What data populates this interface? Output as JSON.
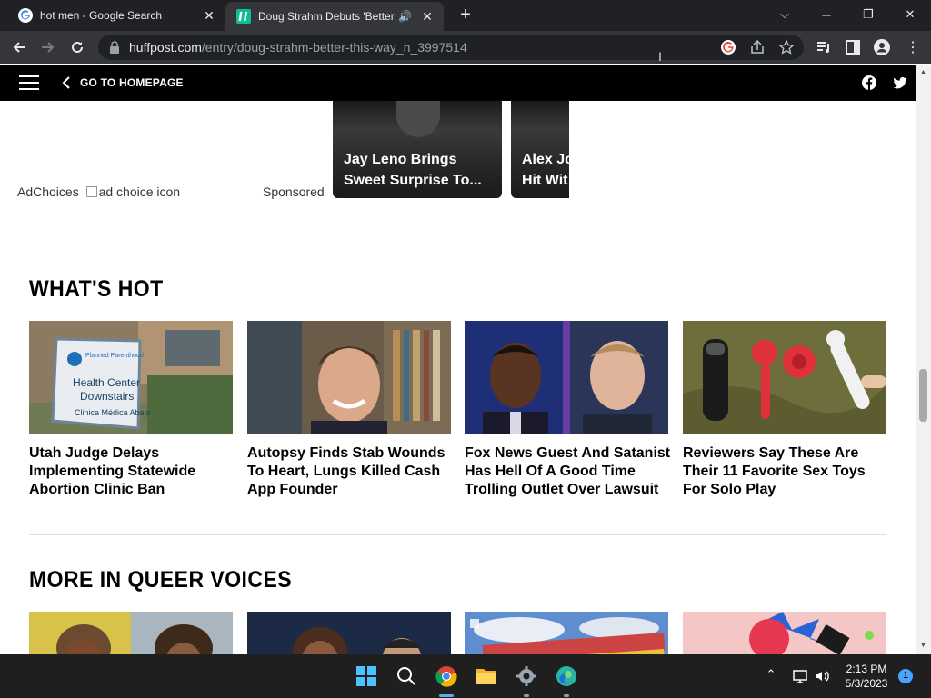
{
  "browser": {
    "tabs": [
      {
        "title": "hot men - Google Search",
        "active": false
      },
      {
        "title": "Doug Strahm Debuts 'Better",
        "active": true,
        "audio": true
      }
    ],
    "url_host": "huffpost.com",
    "url_path": "/entry/doug-strahm-better-this-way_n_3997514"
  },
  "site_header": {
    "home_label": "GO TO HOMEPAGE"
  },
  "ad_row": {
    "adchoices_label": "AdChoices",
    "adchoices_alt": "ad choice icon",
    "sponsored_label": "Sponsored",
    "cards": [
      {
        "line1": "Jay Leno Brings",
        "line2": "Sweet Surprise To..."
      },
      {
        "line1": "Alex Jo",
        "line2": "Hit Wit"
      }
    ]
  },
  "whats_hot": {
    "title": "WHAT'S HOT",
    "items": [
      {
        "headline": "Utah Judge Delays Implementing Statewide Abortion Clinic Ban"
      },
      {
        "headline": "Autopsy Finds Stab Wounds To Heart, Lungs Killed Cash App Founder"
      },
      {
        "headline": "Fox News Guest And Satanist Has Hell Of A Good Time Trolling Outlet Over Lawsuit"
      },
      {
        "headline": "Reviewers Say These Are Their 11 Favorite Sex Toys For Solo Play"
      }
    ],
    "sign_text": {
      "brand": "Planned Parenthood",
      "line1": "Health Center",
      "line2": "Downstairs",
      "line3": "Clinica Médica Abajo"
    }
  },
  "more_in_queer_voices": {
    "title": "MORE IN QUEER VOICES"
  },
  "taskbar": {
    "time": "2:13 PM",
    "date": "5/3/2023",
    "notification_count": "1"
  },
  "colors": {
    "chrome_dark": "#202124",
    "chrome_toolbar": "#35363a",
    "site_header": "#000000",
    "taskbar": "#1f1f1f"
  }
}
